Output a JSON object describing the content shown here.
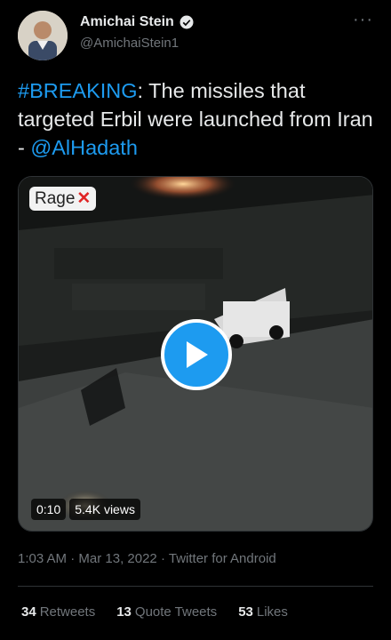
{
  "author": {
    "display_name": "Amichai Stein",
    "handle": "@AmichaiStein1",
    "more_label": "···"
  },
  "tweet": {
    "hashtag": "#BREAKING",
    "text_body": ": The missiles that targeted Erbil were launched from Iran - ",
    "mention": "@AlHadath"
  },
  "media": {
    "watermark": "Rage",
    "duration": "0:10",
    "views": "5.4K views"
  },
  "meta": {
    "time": "1:03 AM",
    "sep1": "·",
    "date": "Mar 13, 2022",
    "sep2": "·",
    "source": "Twitter for Android"
  },
  "stats": {
    "retweets_count": "34",
    "retweets_label": "Retweets",
    "quotes_count": "13",
    "quotes_label": "Quote Tweets",
    "likes_count": "53",
    "likes_label": "Likes"
  },
  "colors": {
    "accent": "#1d9bf0",
    "text": "#e7e9ea",
    "muted": "#71767b",
    "background": "#000000"
  }
}
